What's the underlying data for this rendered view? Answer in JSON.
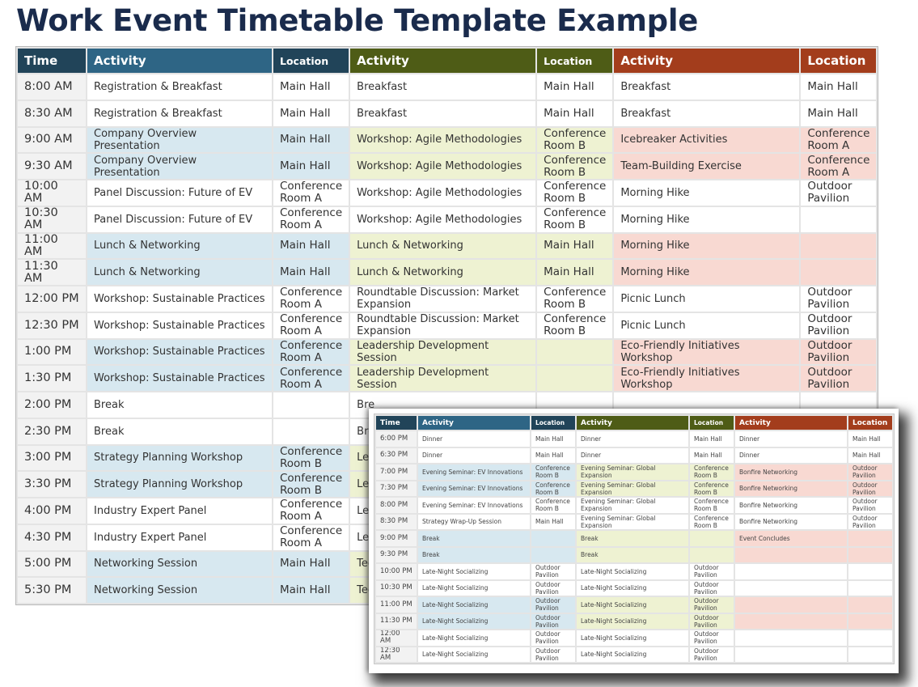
{
  "title": "Work Event Timetable Template Example",
  "colors": {
    "title": "#1a2b4c",
    "header_time": "#214459",
    "header_blue_activity": "#2e6585",
    "header_blue_location": "#214459",
    "header_olive": "#4e5c16",
    "header_rust": "#a33d1c",
    "fill_blue": "#d7e8f0",
    "fill_olive": "#eef2d2",
    "fill_rust": "#f8d9d2"
  },
  "headers": {
    "time": "Time",
    "activity": "Activity",
    "location": "Location"
  },
  "main_table": {
    "rows": [
      {
        "time": "8:00 AM",
        "hl": [
          false,
          false,
          false
        ],
        "t1": [
          "Registration & Breakfast",
          "Main Hall"
        ],
        "t2": [
          "Breakfast",
          "Main Hall"
        ],
        "t3": [
          "Breakfast",
          "Main Hall"
        ]
      },
      {
        "time": "8:30 AM",
        "hl": [
          false,
          false,
          false
        ],
        "t1": [
          "Registration & Breakfast",
          "Main Hall"
        ],
        "t2": [
          "Breakfast",
          "Main Hall"
        ],
        "t3": [
          "Breakfast",
          "Main Hall"
        ]
      },
      {
        "time": "9:00 AM",
        "hl": [
          true,
          true,
          true
        ],
        "t1": [
          "Company Overview Presentation",
          "Main Hall"
        ],
        "t2": [
          "Workshop: Agile Methodologies",
          "Conference Room B"
        ],
        "t3": [
          "Icebreaker Activities",
          "Conference Room A"
        ]
      },
      {
        "time": "9:30 AM",
        "hl": [
          true,
          true,
          true
        ],
        "t1": [
          "Company Overview Presentation",
          "Main Hall"
        ],
        "t2": [
          "Workshop: Agile Methodologies",
          "Conference Room B"
        ],
        "t3": [
          "Team-Building Exercise",
          "Conference Room A"
        ]
      },
      {
        "time": "10:00 AM",
        "hl": [
          false,
          false,
          false
        ],
        "t1": [
          "Panel Discussion: Future of EV",
          "Conference Room A"
        ],
        "t2": [
          "Workshop: Agile Methodologies",
          "Conference Room B"
        ],
        "t3": [
          "Morning Hike",
          "Outdoor Pavilion"
        ]
      },
      {
        "time": "10:30 AM",
        "hl": [
          false,
          false,
          false
        ],
        "t1": [
          "Panel Discussion: Future of EV",
          "Conference Room A"
        ],
        "t2": [
          "Workshop: Agile Methodologies",
          "Conference Room B"
        ],
        "t3": [
          "Morning Hike",
          ""
        ]
      },
      {
        "time": "11:00 AM",
        "hl": [
          true,
          true,
          true
        ],
        "t1": [
          "Lunch & Networking",
          "Main Hall"
        ],
        "t2": [
          "Lunch & Networking",
          "Main Hall"
        ],
        "t3": [
          "Morning Hike",
          ""
        ]
      },
      {
        "time": "11:30 AM",
        "hl": [
          true,
          true,
          true
        ],
        "t1": [
          "Lunch & Networking",
          "Main Hall"
        ],
        "t2": [
          "Lunch & Networking",
          "Main Hall"
        ],
        "t3": [
          "Morning Hike",
          ""
        ]
      },
      {
        "time": "12:00 PM",
        "hl": [
          false,
          false,
          false
        ],
        "t1": [
          "Workshop: Sustainable Practices",
          "Conference Room A"
        ],
        "t2": [
          "Roundtable Discussion: Market Expansion",
          "Conference Room B"
        ],
        "t3": [
          "Picnic Lunch",
          "Outdoor Pavilion"
        ]
      },
      {
        "time": "12:30 PM",
        "hl": [
          false,
          false,
          false
        ],
        "t1": [
          "Workshop: Sustainable Practices",
          "Conference Room A"
        ],
        "t2": [
          "Roundtable Discussion: Market Expansion",
          "Conference Room B"
        ],
        "t3": [
          "Picnic Lunch",
          "Outdoor Pavilion"
        ]
      },
      {
        "time": "1:00 PM",
        "hl": [
          true,
          true,
          true
        ],
        "t1": [
          "Workshop: Sustainable Practices",
          "Conference Room A"
        ],
        "t2": [
          "Leadership Development Session",
          ""
        ],
        "t3": [
          "Eco-Friendly Initiatives Workshop",
          "Outdoor Pavilion"
        ]
      },
      {
        "time": "1:30 PM",
        "hl": [
          true,
          true,
          true
        ],
        "t1": [
          "Workshop: Sustainable Practices",
          "Conference Room A"
        ],
        "t2": [
          "Leadership Development Session",
          ""
        ],
        "t3": [
          "Eco-Friendly Initiatives Workshop",
          "Outdoor Pavilion"
        ]
      },
      {
        "time": "2:00 PM",
        "hl": [
          false,
          false,
          false
        ],
        "t1": [
          "Break",
          ""
        ],
        "t2": [
          "Bre",
          ""
        ],
        "t3": [
          "",
          ""
        ]
      },
      {
        "time": "2:30 PM",
        "hl": [
          false,
          false,
          false
        ],
        "t1": [
          "Break",
          ""
        ],
        "t2": [
          "Bre",
          ""
        ],
        "t3": [
          "",
          ""
        ]
      },
      {
        "time": "3:00 PM",
        "hl": [
          true,
          true,
          true
        ],
        "t1": [
          "Strategy Planning Workshop",
          "Conference Room B"
        ],
        "t2": [
          "Lea",
          ""
        ],
        "t3": [
          "",
          ""
        ]
      },
      {
        "time": "3:30 PM",
        "hl": [
          true,
          true,
          true
        ],
        "t1": [
          "Strategy Planning Workshop",
          "Conference Room B"
        ],
        "t2": [
          "Lea",
          ""
        ],
        "t3": [
          "",
          ""
        ]
      },
      {
        "time": "4:00 PM",
        "hl": [
          false,
          false,
          false
        ],
        "t1": [
          "Industry Expert Panel",
          "Conference Room A"
        ],
        "t2": [
          "Lea",
          ""
        ],
        "t3": [
          "",
          ""
        ]
      },
      {
        "time": "4:30 PM",
        "hl": [
          false,
          false,
          false
        ],
        "t1": [
          "Industry Expert Panel",
          "Conference Room A"
        ],
        "t2": [
          "Lea",
          ""
        ],
        "t3": [
          "",
          ""
        ]
      },
      {
        "time": "5:00 PM",
        "hl": [
          true,
          true,
          true
        ],
        "t1": [
          "Networking Session",
          "Main Hall"
        ],
        "t2": [
          "Tec",
          ""
        ],
        "t3": [
          "",
          ""
        ]
      },
      {
        "time": "5:30 PM",
        "hl": [
          true,
          true,
          true
        ],
        "t1": [
          "Networking Session",
          "Main Hall"
        ],
        "t2": [
          "Tec",
          ""
        ],
        "t3": [
          "",
          ""
        ]
      }
    ]
  },
  "overlay_table": {
    "rows": [
      {
        "time": "6:00 PM",
        "hl": [
          false,
          false,
          false
        ],
        "t1": [
          "Dinner",
          "Main Hall"
        ],
        "t2": [
          "Dinner",
          "Main Hall"
        ],
        "t3": [
          "Dinner",
          "Main Hall"
        ]
      },
      {
        "time": "6:30 PM",
        "hl": [
          false,
          false,
          false
        ],
        "t1": [
          "Dinner",
          "Main Hall"
        ],
        "t2": [
          "Dinner",
          "Main Hall"
        ],
        "t3": [
          "Dinner",
          "Main Hall"
        ]
      },
      {
        "time": "7:00 PM",
        "hl": [
          true,
          true,
          true
        ],
        "t1": [
          "Evening Seminar: EV Innovations",
          "Conference Room B"
        ],
        "t2": [
          "Evening Seminar: Global Expansion",
          "Conference Room B"
        ],
        "t3": [
          "Bonfire Networking",
          "Outdoor Pavilion"
        ]
      },
      {
        "time": "7:30 PM",
        "hl": [
          true,
          true,
          true
        ],
        "t1": [
          "Evening Seminar: EV Innovations",
          "Conference Room B"
        ],
        "t2": [
          "Evening Seminar: Global Expansion",
          "Conference Room B"
        ],
        "t3": [
          "Bonfire Networking",
          "Outdoor Pavilion"
        ]
      },
      {
        "time": "8:00 PM",
        "hl": [
          false,
          false,
          false
        ],
        "t1": [
          "Evening Seminar: EV Innovations",
          "Conference Room B"
        ],
        "t2": [
          "Evening Seminar: Global Expansion",
          "Conference Room B"
        ],
        "t3": [
          "Bonfire Networking",
          "Outdoor Pavilion"
        ]
      },
      {
        "time": "8:30 PM",
        "hl": [
          false,
          false,
          false
        ],
        "t1": [
          "Strategy Wrap-Up Session",
          "Main Hall"
        ],
        "t2": [
          "Evening Seminar: Global Expansion",
          "Conference Room B"
        ],
        "t3": [
          "Bonfire Networking",
          "Outdoor Pavilion"
        ]
      },
      {
        "time": "9:00 PM",
        "hl": [
          true,
          true,
          true
        ],
        "t1": [
          "Break",
          ""
        ],
        "t2": [
          "Break",
          ""
        ],
        "t3": [
          "Event Concludes",
          ""
        ]
      },
      {
        "time": "9:30 PM",
        "hl": [
          true,
          true,
          true
        ],
        "t1": [
          "Break",
          ""
        ],
        "t2": [
          "Break",
          ""
        ],
        "t3": [
          "",
          ""
        ]
      },
      {
        "time": "10:00 PM",
        "hl": [
          false,
          false,
          false
        ],
        "t1": [
          "Late-Night Socializing",
          "Outdoor Pavilion"
        ],
        "t2": [
          "Late-Night Socializing",
          "Outdoor Pavilion"
        ],
        "t3": [
          "",
          ""
        ]
      },
      {
        "time": "10:30 PM",
        "hl": [
          false,
          false,
          false
        ],
        "t1": [
          "Late-Night Socializing",
          "Outdoor Pavilion"
        ],
        "t2": [
          "Late-Night Socializing",
          "Outdoor Pavilion"
        ],
        "t3": [
          "",
          ""
        ]
      },
      {
        "time": "11:00 PM",
        "hl": [
          true,
          true,
          true
        ],
        "t1": [
          "Late-Night Socializing",
          "Outdoor Pavilion"
        ],
        "t2": [
          "Late-Night Socializing",
          "Outdoor Pavilion"
        ],
        "t3": [
          "",
          ""
        ]
      },
      {
        "time": "11:30 PM",
        "hl": [
          true,
          true,
          true
        ],
        "t1": [
          "Late-Night Socializing",
          "Outdoor Pavilion"
        ],
        "t2": [
          "Late-Night Socializing",
          "Outdoor Pavilion"
        ],
        "t3": [
          "",
          ""
        ]
      },
      {
        "time": "12:00 AM",
        "hl": [
          false,
          false,
          false
        ],
        "t1": [
          "Late-Night Socializing",
          "Outdoor Pavilion"
        ],
        "t2": [
          "Late-Night Socializing",
          "Outdoor Pavilion"
        ],
        "t3": [
          "",
          ""
        ]
      },
      {
        "time": "12:30 AM",
        "hl": [
          false,
          false,
          false
        ],
        "t1": [
          "Late-Night Socializing",
          "Outdoor Pavilion"
        ],
        "t2": [
          "Late-Night Socializing",
          "Outdoor Pavilion"
        ],
        "t3": [
          "",
          ""
        ]
      }
    ]
  }
}
